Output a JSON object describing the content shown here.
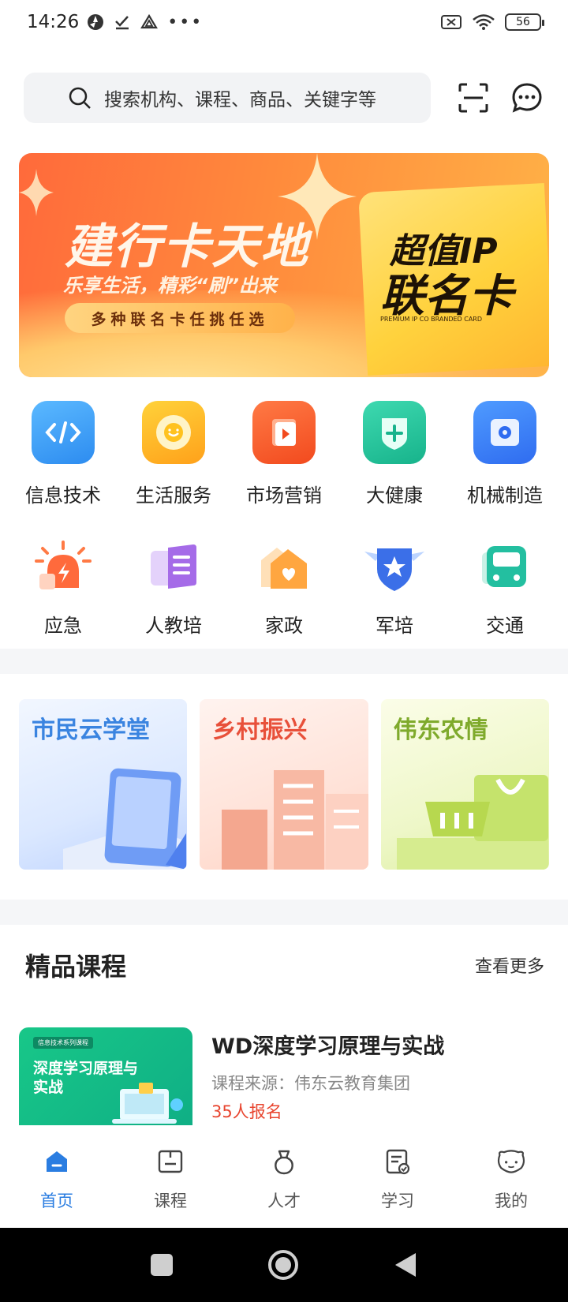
{
  "status": {
    "time": "14:26",
    "battery": "56"
  },
  "search": {
    "placeholder": "搜索机构、课程、商品、关键字等"
  },
  "banner": {
    "title": "建行卡天地",
    "subtitle": "乐享生活，精彩“刷”出来",
    "pill": "多种联名卡任挑任选",
    "card_line1": "超值IP",
    "card_line2": "联名卡",
    "card_en": "PREMIUM IP CO BRANDED CARD"
  },
  "categories": [
    {
      "label": "信息技术",
      "icon": "code-icon",
      "color": "#3aa3f5"
    },
    {
      "label": "生活服务",
      "icon": "smile-icon",
      "color": "#ffb21f"
    },
    {
      "label": "市场营销",
      "icon": "play-icon",
      "color": "#ff5a2e"
    },
    {
      "label": "大健康",
      "icon": "plus-shield-icon",
      "color": "#23c39a"
    },
    {
      "label": "机械制造",
      "icon": "gear-icon",
      "color": "#3a7bf2"
    },
    {
      "label": "应急",
      "icon": "alarm-icon",
      "color": "#ff6a3c"
    },
    {
      "label": "人教培",
      "icon": "book-icon",
      "color": "#a56be8"
    },
    {
      "label": "家政",
      "icon": "heart-house-icon",
      "color": "#ffa640"
    },
    {
      "label": "军培",
      "icon": "star-badge-icon",
      "color": "#3b6fe8"
    },
    {
      "label": "交通",
      "icon": "bus-icon",
      "color": "#23bfa0"
    }
  ],
  "features": [
    {
      "title": "市民云学堂",
      "color": "#3a84e0"
    },
    {
      "title": "乡村振兴",
      "color": "#e8503a"
    },
    {
      "title": "伟东农情",
      "color": "#7faa2c"
    }
  ],
  "courses_section": {
    "title": "精品课程",
    "more": "查看更多"
  },
  "course": {
    "thumb_tag": "信息技术系列课程",
    "thumb_title": "深度学习原理与实战",
    "name": "WD深度学习原理与实战",
    "source": "课程来源：伟东云教育集团",
    "signups": "35人报名"
  },
  "nav": [
    {
      "label": "首页",
      "icon": "home-icon",
      "active": true
    },
    {
      "label": "课程",
      "icon": "course-icon"
    },
    {
      "label": "人才",
      "icon": "talent-icon"
    },
    {
      "label": "学习",
      "icon": "study-icon"
    },
    {
      "label": "我的",
      "icon": "profile-icon"
    }
  ]
}
